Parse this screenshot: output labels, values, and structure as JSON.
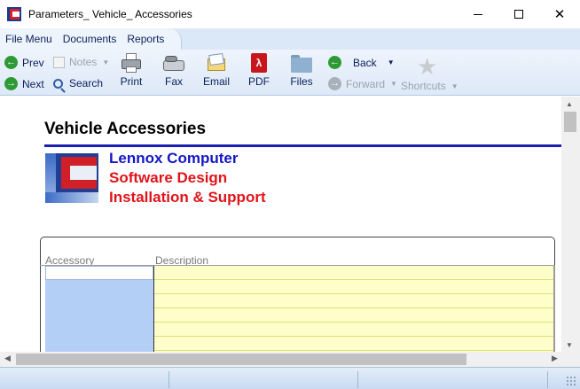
{
  "window": {
    "title": "Parameters_ Vehicle_ Accessories"
  },
  "menu": {
    "items": [
      "File Menu",
      "Documents",
      "Reports"
    ]
  },
  "toolbar": {
    "prev_label": "Prev",
    "next_label": "Next",
    "notes_label": "Notes",
    "search_label": "Search",
    "print_label": "Print",
    "fax_label": "Fax",
    "email_label": "Email",
    "pdf_label": "PDF",
    "files_label": "Files",
    "back_label": "Back",
    "forward_label": "Forward",
    "shortcuts_label": "Shortcuts"
  },
  "document": {
    "title": "Vehicle Accessories",
    "company_line1": "Lennox Computer",
    "company_line2": "Software Design",
    "company_line3": "Installation & Support",
    "columns": [
      "Accessory",
      "Description"
    ]
  },
  "colors": {
    "rule": "#1a1fb4",
    "company_blue": "#1515c8",
    "company_red": "#e0141a",
    "accessory_column": "#b3cff5",
    "description_column": "#fefeca"
  }
}
